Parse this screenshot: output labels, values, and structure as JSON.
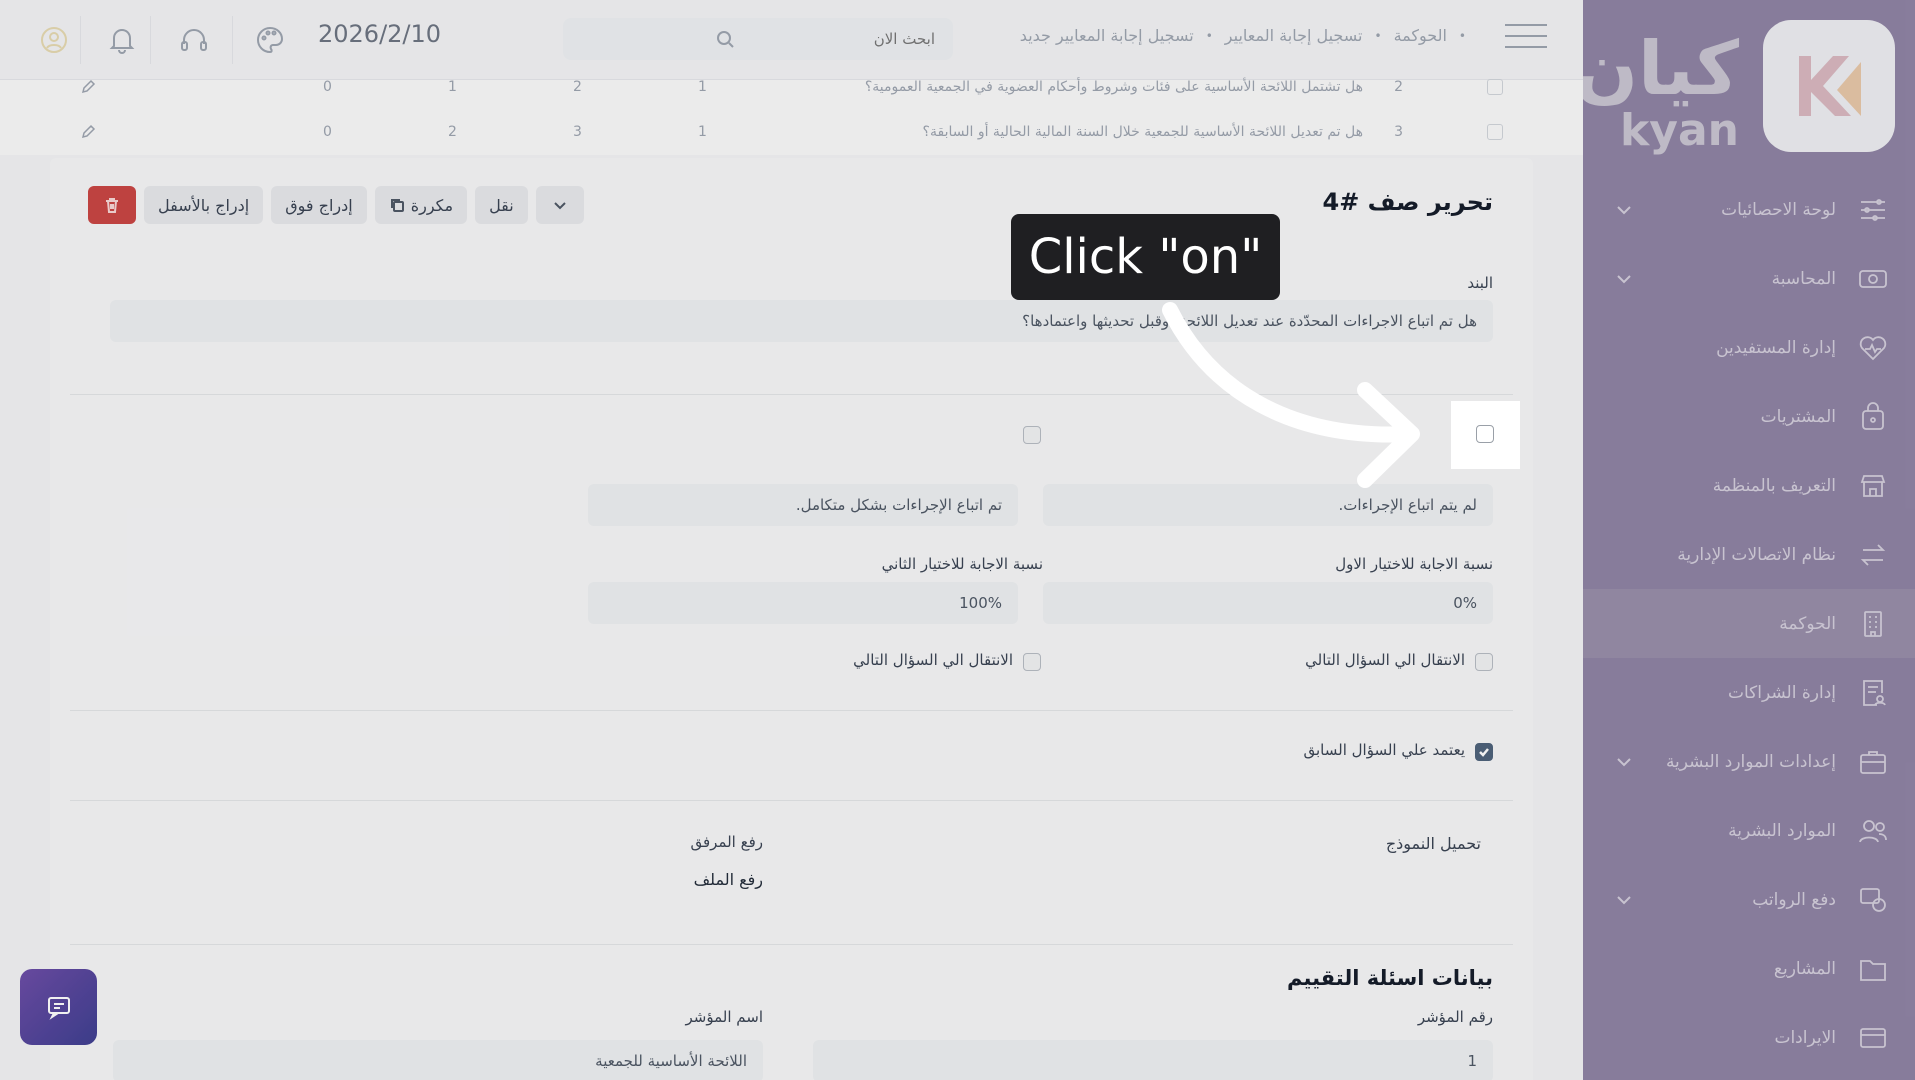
{
  "sidebar": {
    "brand_ar": "كيان",
    "brand_en": "kyan",
    "items": [
      {
        "label": "لوحة الاحصائيات",
        "icon": "sliders-icon",
        "chevron": true
      },
      {
        "label": "المحاسبة",
        "icon": "money-icon",
        "chevron": true
      },
      {
        "label": "إدارة المستفيدين",
        "icon": "heart-pulse-icon",
        "chevron": false
      },
      {
        "label": "المشتريات",
        "icon": "shopping-bag-icon",
        "chevron": false
      },
      {
        "label": "التعريف بالمنظمة",
        "icon": "store-icon",
        "chevron": false
      },
      {
        "label": "نظام الاتصالات الإدارية",
        "icon": "arrows-exchange-icon",
        "chevron": false
      },
      {
        "label": "الحوكمة",
        "icon": "building-icon",
        "chevron": false,
        "active": true
      },
      {
        "label": "إدارة الشراكات",
        "icon": "document-user-icon",
        "chevron": false
      },
      {
        "label": "إعدادات الموارد البشرية",
        "icon": "briefcase-icon",
        "chevron": true
      },
      {
        "label": "الموارد البشرية",
        "icon": "users-icon",
        "chevron": false
      },
      {
        "label": "دفع الرواتب",
        "icon": "coins-icon",
        "chevron": true
      },
      {
        "label": "المشاريع",
        "icon": "folder-icon",
        "chevron": false
      },
      {
        "label": "الايرادات",
        "icon": "card-icon",
        "chevron": false
      }
    ]
  },
  "header": {
    "breadcrumb": [
      "الحوكمة",
      "تسجيل إجابة المعايير",
      "تسجيل إجابة المعايير جديد"
    ],
    "search_placeholder": "ابحث الان",
    "date": "2026/2/10"
  },
  "bg_rows": [
    {
      "num": "2",
      "question": "هل تشتمل اللائحة الأساسية على فئات وشروط وأحكام العضوية في الجمعية العمومية؟",
      "values": [
        "1",
        "2",
        "1",
        "0"
      ]
    },
    {
      "num": "3",
      "question": "هل تم تعديل اللائحة الأساسية للجمعية خلال السنة المالية الحالية أو السابقة؟",
      "values": [
        "1",
        "3",
        "2",
        "0"
      ]
    }
  ],
  "editor": {
    "title": "تحرير صف #4",
    "toolbar": {
      "insert_below": "إدراج بالأسفل",
      "insert_above": "إدراج فوق",
      "duplicate": "مكررة",
      "move": "نقل"
    },
    "item_label": "البند",
    "item_value": "هل تم اتباع الاجراءات المحدّدة عند تعديل اللائحة، وقبل تحديثها واعتمادها؟",
    "option1_text": "لم يتم اتباع الإجراءات.",
    "option2_text": "تم اتباع الإجراءات بشكل متكامل.",
    "ratio1_label": "نسبة الاجابة للاختيار الاول",
    "ratio1_value": "0%",
    "ratio2_label": "نسبة الاجابة للاختيار الثاني",
    "ratio2_value": "100%",
    "next_q1": "الانتقال الي السؤال التالي",
    "next_q2": "الانتقال الي السؤال التالي",
    "depends_prev": "يعتمد علي السؤال السابق",
    "download_template": "تحميل النموذج",
    "upload_attachment_label": "رفع المرفق",
    "upload_file": "رفع الملف",
    "eval_section_title": "بيانات اسئلة التقييم",
    "indicator_num_label": "رقم المؤشر",
    "indicator_num_value": "1",
    "indicator_name_label": "اسم المؤشر",
    "indicator_name_value": "اللائحة الأساسية للجمعية"
  },
  "overlay": {
    "tooltip": "Click \"on\""
  },
  "colors": {
    "sidebar": "#8e82a3",
    "danger": "#c94340",
    "tooltip_bg": "#1f1f22"
  }
}
